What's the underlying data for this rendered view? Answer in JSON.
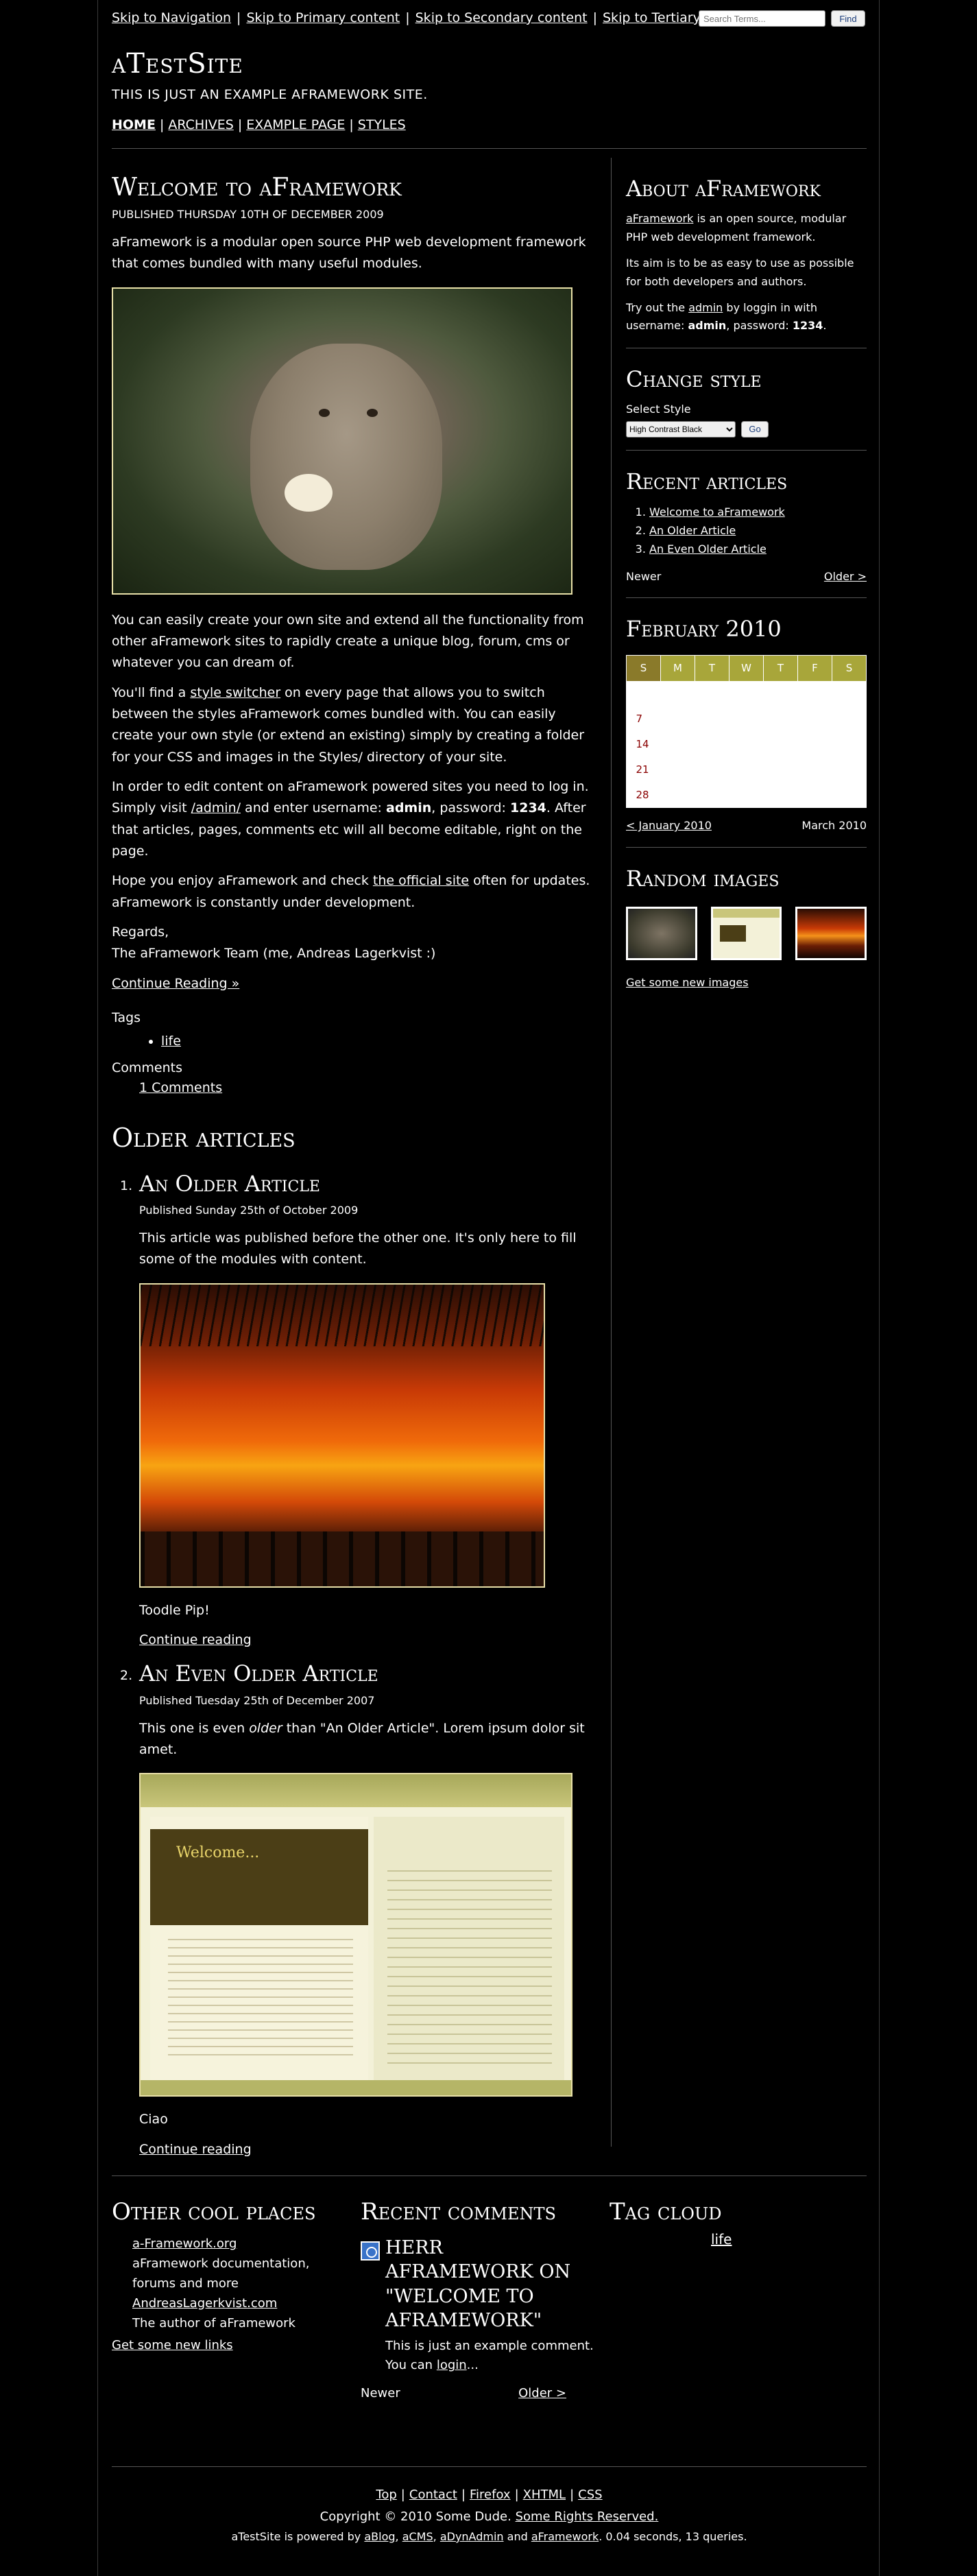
{
  "skip_links": [
    "Skip to Navigation",
    "Skip to Primary content",
    "Skip to Secondary content",
    "Skip to Tertiary content"
  ],
  "search": {
    "placeholder": "Search Terms...",
    "button": "Find"
  },
  "site": {
    "title": "aTestSite",
    "tagline": "This is just an example aFramework site."
  },
  "nav": [
    "Home",
    "Archives",
    "Example Page",
    "Styles"
  ],
  "post": {
    "title": "Welcome to aFramework",
    "published": "Published Thursday 10th of December 2009",
    "intro": "aFramework is a modular open source PHP web development framework that comes bundled with many useful modules.",
    "p1": "You can easily create your own site and extend all the functionality from other aFramework sites to rapidly create a unique blog, forum, cms or whatever you can dream of.",
    "p2_a": "You'll find a ",
    "p2_link": "style switcher",
    "p2_b": " on every page that allows you to switch between the styles aFramework comes bundled with. You can easily create your own style (or extend an existing) simply by creating a folder for your CSS and images in the Styles/ directory of your site.",
    "p3_a": "In order to edit content on aFramework powered sites you need to log in. Simply visit ",
    "p3_link": "/admin/",
    "p3_b": " and enter username: ",
    "p3_user": "admin",
    "p3_c": ", password: ",
    "p3_pass": "1234",
    "p3_d": ". After that articles, pages, comments etc will all become editable, right on the page.",
    "p4_a": "Hope you enjoy aFramework and check ",
    "p4_link": "the official site",
    "p4_b": " often for updates. aFramework is constantly under development.",
    "regards": "Regards,",
    "team": "The aFramework Team (me, Andreas Lagerkvist :)",
    "continue": "Continue Reading »",
    "tags_label": "Tags",
    "tag": "life",
    "comments_label": "Comments",
    "comments_link": "1 Comments"
  },
  "older": {
    "heading": "Older articles",
    "items": [
      {
        "num": "1.",
        "title": "An Older Article",
        "meta": "Published Sunday 25th of October 2009",
        "body": "This article was published before the other one. It's only here to fill some of the modules with content.",
        "after": "Toodle Pip!",
        "more": "Continue reading"
      },
      {
        "num": "2.",
        "title": "An Even Older Article",
        "meta": "Published Tuesday 25th of December 2007",
        "body_a": "This one is even ",
        "body_em": "older",
        "body_b": " than \"An Older Article\". Lorem ipsum dolor sit amet.",
        "after": "Ciao",
        "more": "Continue reading",
        "shot_welcome": "Welcome..."
      }
    ]
  },
  "sidebar": {
    "about": {
      "title": "About aFramework",
      "p1_link": "aFramework",
      "p1": " is an open source, modular PHP web development framework.",
      "p2": "Its aim is to be as easy to use as possible for both developers and authors.",
      "p3_a": "Try out the ",
      "p3_link": "admin",
      "p3_b": " by loggin in with username: ",
      "p3_user": "admin",
      "p3_c": ", password: ",
      "p3_pass": "1234",
      "p3_d": "."
    },
    "style": {
      "title": "Change style",
      "label": "Select Style",
      "selected": "High Contrast Black",
      "button": "Go"
    },
    "recent": {
      "title": "Recent articles",
      "items": [
        "Welcome to aFramework",
        "An Older Article",
        "An Even Older Article"
      ],
      "newer": "Newer",
      "older": "Older >"
    },
    "calendar": {
      "title": "February 2010",
      "days": [
        "S",
        "M",
        "T",
        "W",
        "T",
        "F",
        "S"
      ],
      "dates": [
        "7",
        "14",
        "21",
        "28"
      ],
      "prev": "< January 2010",
      "next": "March 2010"
    },
    "images": {
      "title": "Random images",
      "link": "Get some new images"
    }
  },
  "footer": {
    "places": {
      "title": "Other cool places",
      "links": [
        {
          "name": "a-Framework.org",
          "desc": "aFramework documentation, forums and more"
        },
        {
          "name": "AndreasLagerkvist.com",
          "desc": "The author of aFramework"
        }
      ],
      "more": "Get some new links"
    },
    "comments": {
      "title": "Recent comments",
      "head": "Herr aFramework on \"Welcome to aFramework\"",
      "body_a": "This is just an example comment. You can ",
      "body_link": "login",
      "body_b": "...",
      "newer": "Newer",
      "older": "Older >"
    },
    "tagcloud": {
      "title": "Tag cloud",
      "tag": "life"
    },
    "bottom_links": [
      "Top",
      "Contact",
      "Firefox",
      "XHTML",
      "CSS"
    ],
    "copyright": "Copyright © 2010 Some Dude.",
    "rights": "Some Rights Reserved.",
    "powered_a": "aTestSite is powered by ",
    "powered_links": [
      "aBlog",
      "aCMS",
      "aDynAdmin",
      "aFramework"
    ],
    "powered_b": ". 0.04 seconds, 13 queries."
  }
}
